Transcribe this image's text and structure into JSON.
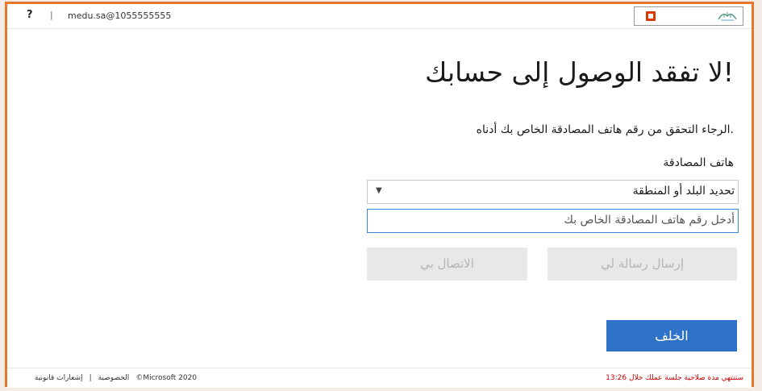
{
  "header": {
    "help": "?",
    "separator": "|",
    "user": "medu.sa@1055555555"
  },
  "main": {
    "title": "لا تفقد الوصول إلى حسابك!",
    "description": "الرجاء التحقق من رقم هاتف المصادقة الخاص بك أدناه.",
    "phone_label": "هاتف المصادقة",
    "country_select": "تحديد البلد أو المنطقة",
    "phone_placeholder": "أدخل رقم هاتف المصادقة الخاص بك",
    "sms_button": "إرسال رسالة لي",
    "call_button": "الاتصال بي",
    "back_button": "الخلف"
  },
  "footer": {
    "copyright": "©Microsoft 2020",
    "legal": "إشعارات قانونية",
    "sep": "|",
    "privacy": "الخصوصية",
    "session": "ستنتهي مدة صلاحية جلسة عملك خلال 13:26"
  },
  "colors": {
    "accent": "#2f73c9",
    "frame": "#e8762b",
    "warning": "#cc0000"
  }
}
